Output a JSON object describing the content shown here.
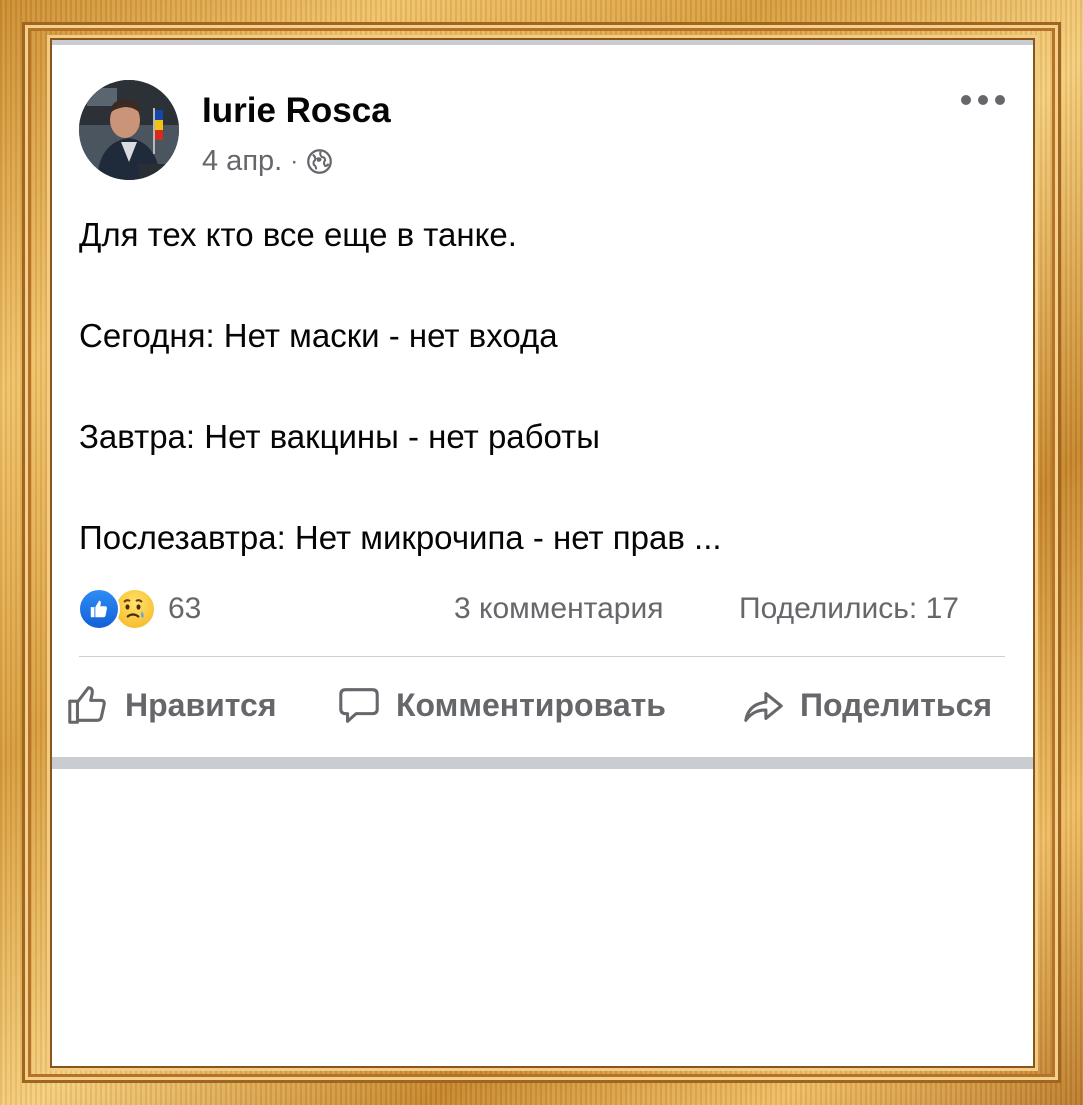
{
  "post": {
    "author": "Iurie Rosca",
    "date": "4 апр.",
    "separator": "·",
    "privacy_icon": "globe-icon",
    "lines": [
      "Для тех кто все еще в танке.",
      "Сегодня: Нет маски - нет входа",
      "Завтра: Нет вакцины - нет работы",
      "Послезавтра: Нет микрочипа - нет прав ..."
    ]
  },
  "stats": {
    "reaction_icons": [
      "like-reaction-icon",
      "sad-reaction-icon"
    ],
    "reactions_count": "63",
    "comments": "3 комментария",
    "shares": "Поделились: 17"
  },
  "actions": {
    "like": "Нравится",
    "comment": "Комментировать",
    "share": "Поделиться"
  },
  "colors": {
    "text": "#050505",
    "secondary": "#65676b",
    "like_blue": "#1877f2",
    "separator": "#c9ccd1",
    "frame_gold": "#d69b3c"
  }
}
